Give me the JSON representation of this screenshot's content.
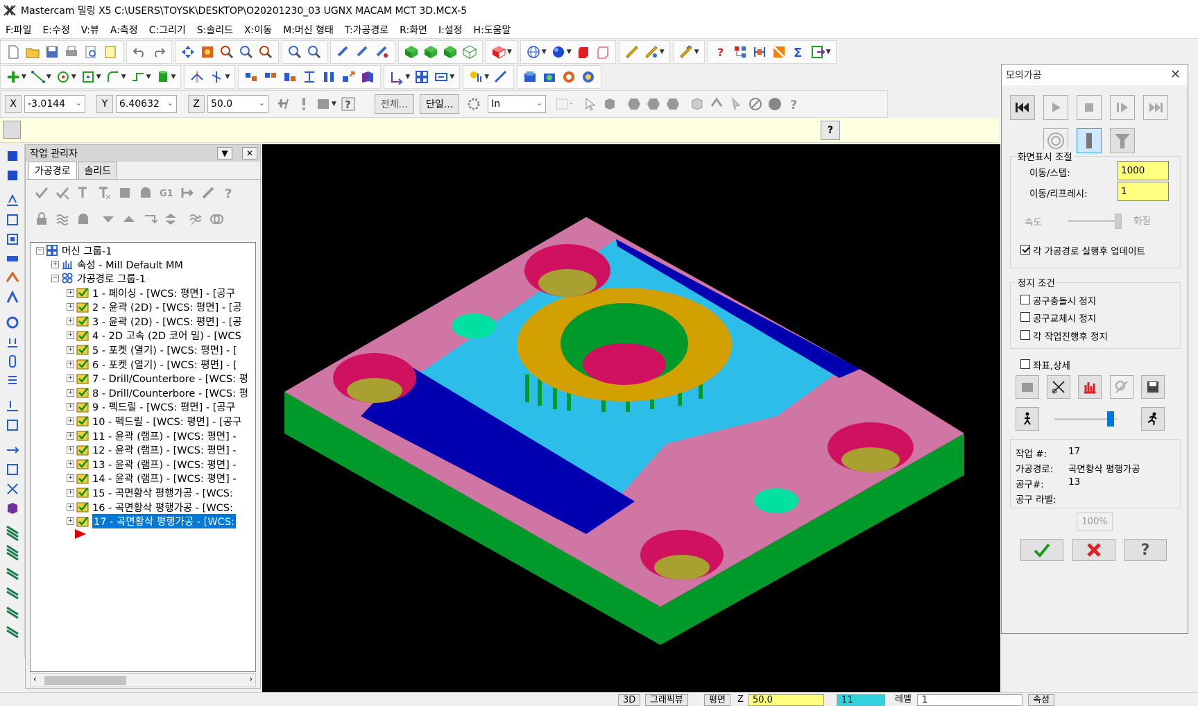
{
  "window": {
    "title": "Mastercam 밀링 X5  C:\\USERS\\TOYSK\\DESKTOP\\O20201230_03 UGNX MACAM MCT 3D.MCX-5"
  },
  "menu": [
    "F:파일",
    "E:수정",
    "V:뷰",
    "A:측정",
    "C:그리기",
    "S:솔리드",
    "X:이동",
    "M:머신 형태",
    "T:가공경로",
    "R:화면",
    "I:설정",
    "H:도움말"
  ],
  "coords": {
    "x_label": "X",
    "x_value": "-3.0144",
    "y_label": "Y",
    "y_value": "6.40632",
    "z_label": "Z",
    "z_value": "50.0"
  },
  "toolbar3": {
    "all_btn": "전체...",
    "single_btn": "단일...",
    "unit": "In"
  },
  "ops_manager": {
    "title": "작업 관리자",
    "tabs": [
      "가공경로",
      "솔리드"
    ],
    "tree": {
      "machine_group": "머신 그룹-1",
      "properties": "속성 - Mill Default MM",
      "toolpath_group": "가공경로 그룹-1",
      "operations": [
        "1 - 페이싱 - [WCS: 평면] - [공구",
        "2 - 윤곽 (2D) - [WCS: 평면] - [공",
        "3 - 윤곽 (2D) - [WCS: 평면] - [공",
        "4 - 2D 고속 (2D 코어 밀) - [WCS",
        "5 - 포켓 (열기) - [WCS: 평면] - [",
        "6 - 포켓 (열기) - [WCS: 평면] - [",
        "7 - Drill/Counterbore - [WCS: 평",
        "8 - Drill/Counterbore - [WCS: 평",
        "9 - 펙드릴 - [WCS: 평면] - [공구",
        "10 - 펙드릴 - [WCS: 평면] - [공구",
        "11 - 윤곽 (램프) - [WCS: 평면] -",
        "12 - 윤곽 (램프) - [WCS: 평면] -",
        "13 - 윤곽 (램프) - [WCS: 평면] -",
        "14 - 윤곽 (램프) - [WCS: 평면] -",
        "15 - 곡면황삭 평행가공 - [WCS:",
        "16 - 곡면황삭 평행가공 - [WCS:",
        "17 - 곡면황삭 평행가공 - [WCS:"
      ]
    }
  },
  "sim_dialog": {
    "title": "모의가공",
    "display_group": "화면표시 조절",
    "step_label": "이동/스텝:",
    "step_value": "1000",
    "refresh_label": "이동/리프레시:",
    "refresh_value": "1",
    "speed_label": "속도",
    "quality_label": "화질",
    "update_label": "각 가공경로 실행후 업데이트",
    "stop_group": "정지 조건",
    "stop_collision": "공구충돌시 정지",
    "stop_toolchange": "공구교체시 정지",
    "stop_each_op": "각 작업진행후  정지",
    "coord_detail": "좌표,상세",
    "info": {
      "op_label": "작업 #:",
      "op_value": "17",
      "path_label": "가공경로:",
      "path_value": "곡면황삭 평행가공",
      "tool_label": "공구#:",
      "tool_value": "13",
      "toollabel_label": "공구 라벨:",
      "toollabel_value": ""
    },
    "progress": "100%"
  },
  "statusbar": {
    "btn_3d": "3D",
    "btn_gview": "그래픽뷰",
    "btn_plane": "평면",
    "z_label": "Z",
    "z_value": "50.0",
    "color_value": "11",
    "level_label": "레벨",
    "level_value": "1",
    "attr_label": "속성"
  },
  "colors": {
    "part_pink": "#cf76a5",
    "part_blue": "#2dbde9",
    "part_navy": "#0000b0",
    "part_green": "#009a2a",
    "part_yellow": "#d2a000",
    "hole_magenta": "#d0115f",
    "hole_olive": "#a8a030",
    "hole_cyan": "#00e0a0",
    "selection": "#0078d7"
  }
}
